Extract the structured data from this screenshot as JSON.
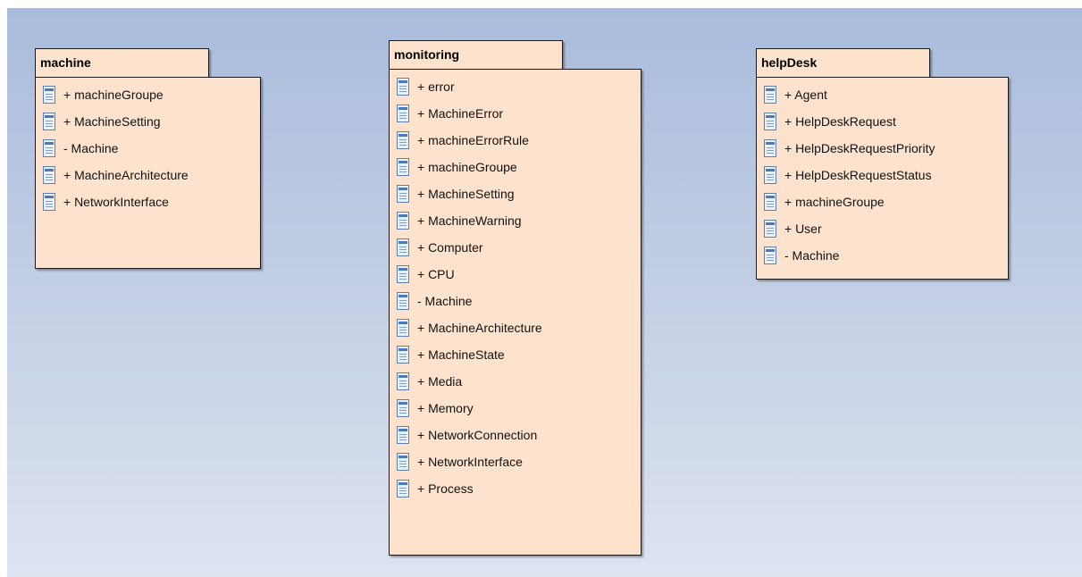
{
  "packages": [
    {
      "name": "machine",
      "items": [
        "+ machineGroupe",
        "+ MachineSetting",
        "- Machine",
        "+ MachineArchitecture",
        "+ NetworkInterface"
      ]
    },
    {
      "name": "monitoring",
      "items": [
        "+ error",
        "+ MachineError",
        "+ machineErrorRule",
        "+ machineGroupe",
        "+ MachineSetting",
        "+ MachineWarning",
        "+ Computer",
        "+ CPU",
        "- Machine",
        "+ MachineArchitecture",
        "+ MachineState",
        "+ Media",
        "+ Memory",
        "+ NetworkConnection",
        "+ NetworkInterface",
        "+ Process"
      ]
    },
    {
      "name": "helpDesk",
      "items": [
        "+ Agent",
        "+ HelpDeskRequest",
        "+ HelpDeskRequestPriority",
        "+ HelpDeskRequestStatus",
        "+ machineGroupe",
        "+ User",
        "- Machine"
      ]
    }
  ],
  "colors": {
    "package_fill": "#fde3cd",
    "border": "#1a1a1a",
    "background_top": "#a9bcdc",
    "background_bottom": "#dde4f0"
  },
  "icons": {
    "item": "class-element-icon"
  }
}
